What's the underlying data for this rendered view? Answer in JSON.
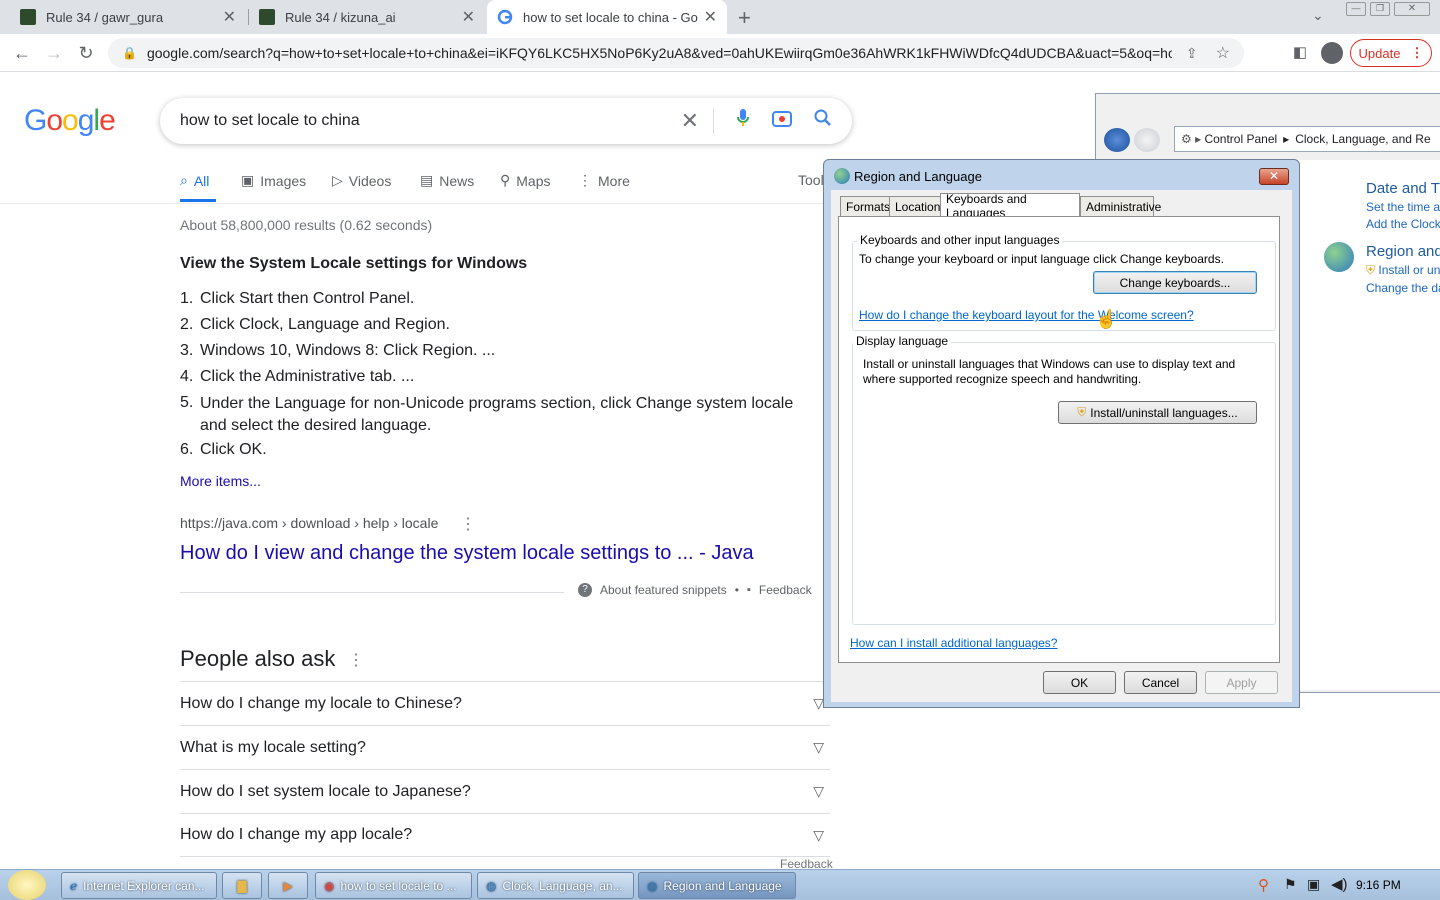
{
  "browser": {
    "tabs": [
      {
        "title": "Rule 34 / gawr_gura",
        "close": "✕"
      },
      {
        "title": "Rule 34 / kizuna_ai",
        "close": "✕"
      },
      {
        "title": "how to set locale to china - Goo",
        "close": "✕"
      }
    ],
    "new_tab": "+",
    "url": "google.com/search?q=how+to+set+locale+to+china&ei=iKFQY6LKC5HX5NoP6Ky2uA8&ved=0ahUKEwiirqGm0e36AhWRK1kFHWiWDfcQ4dUDCBA&uact=5&oq=how+to...",
    "update_label": "Update"
  },
  "google": {
    "logo_letters": [
      {
        "ch": "G",
        "color": "#4285f4"
      },
      {
        "ch": "o",
        "color": "#ea4335"
      },
      {
        "ch": "o",
        "color": "#fbbc05"
      },
      {
        "ch": "g",
        "color": "#4285f4"
      },
      {
        "ch": "l",
        "color": "#34a853"
      },
      {
        "ch": "e",
        "color": "#ea4335"
      }
    ],
    "query": "how to set locale to china",
    "nav": {
      "all": "All",
      "images": "Images",
      "videos": "Videos",
      "news": "News",
      "maps": "Maps",
      "more": "More",
      "tools": "Tools"
    },
    "stats": "About 58,800,000 results (0.62 seconds)",
    "snippet_title": "View the System Locale settings for Windows",
    "steps": [
      {
        "n": "1.",
        "text": "Click Start then Control Panel."
      },
      {
        "n": "2.",
        "text": "Click Clock, Language and Region."
      },
      {
        "n": "3.",
        "text": "Windows 10, Windows 8: Click Region. ..."
      },
      {
        "n": "4.",
        "text": "Click the Administrative tab. ..."
      },
      {
        "n": "5.",
        "text": "Under the Language for non-Unicode programs section, click Change system locale and select the desired language."
      },
      {
        "n": "6.",
        "text": "Click OK."
      }
    ],
    "more_items": "More items...",
    "source_url": "https://java.com › download › help › locale",
    "result_link": "How do I view and change the system locale settings to ... - Java",
    "about_snippets": "About featured snippets",
    "feedback_short": "Feedback",
    "paa_title": "People also ask",
    "paa": [
      "How do I change my locale to Chinese?",
      "What is my locale setting?",
      "How do I set system locale to Japanese?",
      "How do I change my app locale?"
    ],
    "feedback": "Feedback"
  },
  "control_panel": {
    "breadcrumb_root": "Control Panel",
    "breadcrumb_current": "Clock, Language, and Re",
    "date_heading": "Date and T",
    "date_link1": "Set the time ar",
    "date_link2": "Add the Clock",
    "region_heading": "Region and",
    "region_link1": "Install or un",
    "region_link2": "Change the da"
  },
  "dialog": {
    "title": "Region and Language",
    "tabs": [
      "Formats",
      "Location",
      "Keyboards and Languages",
      "Administrative"
    ],
    "kb_group": "Keyboards and other input languages",
    "kb_text": "To change your keyboard or input language click Change keyboards.",
    "change_keyboards": "Change keyboards...",
    "welcome_link": "How do I change the keyboard layout for the Welcome screen?",
    "display_group": "Display language",
    "display_text": "Install or uninstall languages that Windows can use to display text and where supported recognize speech and handwriting.",
    "install_button": "Install/uninstall languages...",
    "additional_link": "How can I install additional languages?",
    "ok": "OK",
    "cancel": "Cancel",
    "apply": "Apply"
  },
  "taskbar": {
    "items": [
      "Internet Explorer can...",
      "how to set locale to ...",
      "Clock, Language, an...",
      "Region and Language"
    ],
    "clock": "9:16 PM"
  }
}
